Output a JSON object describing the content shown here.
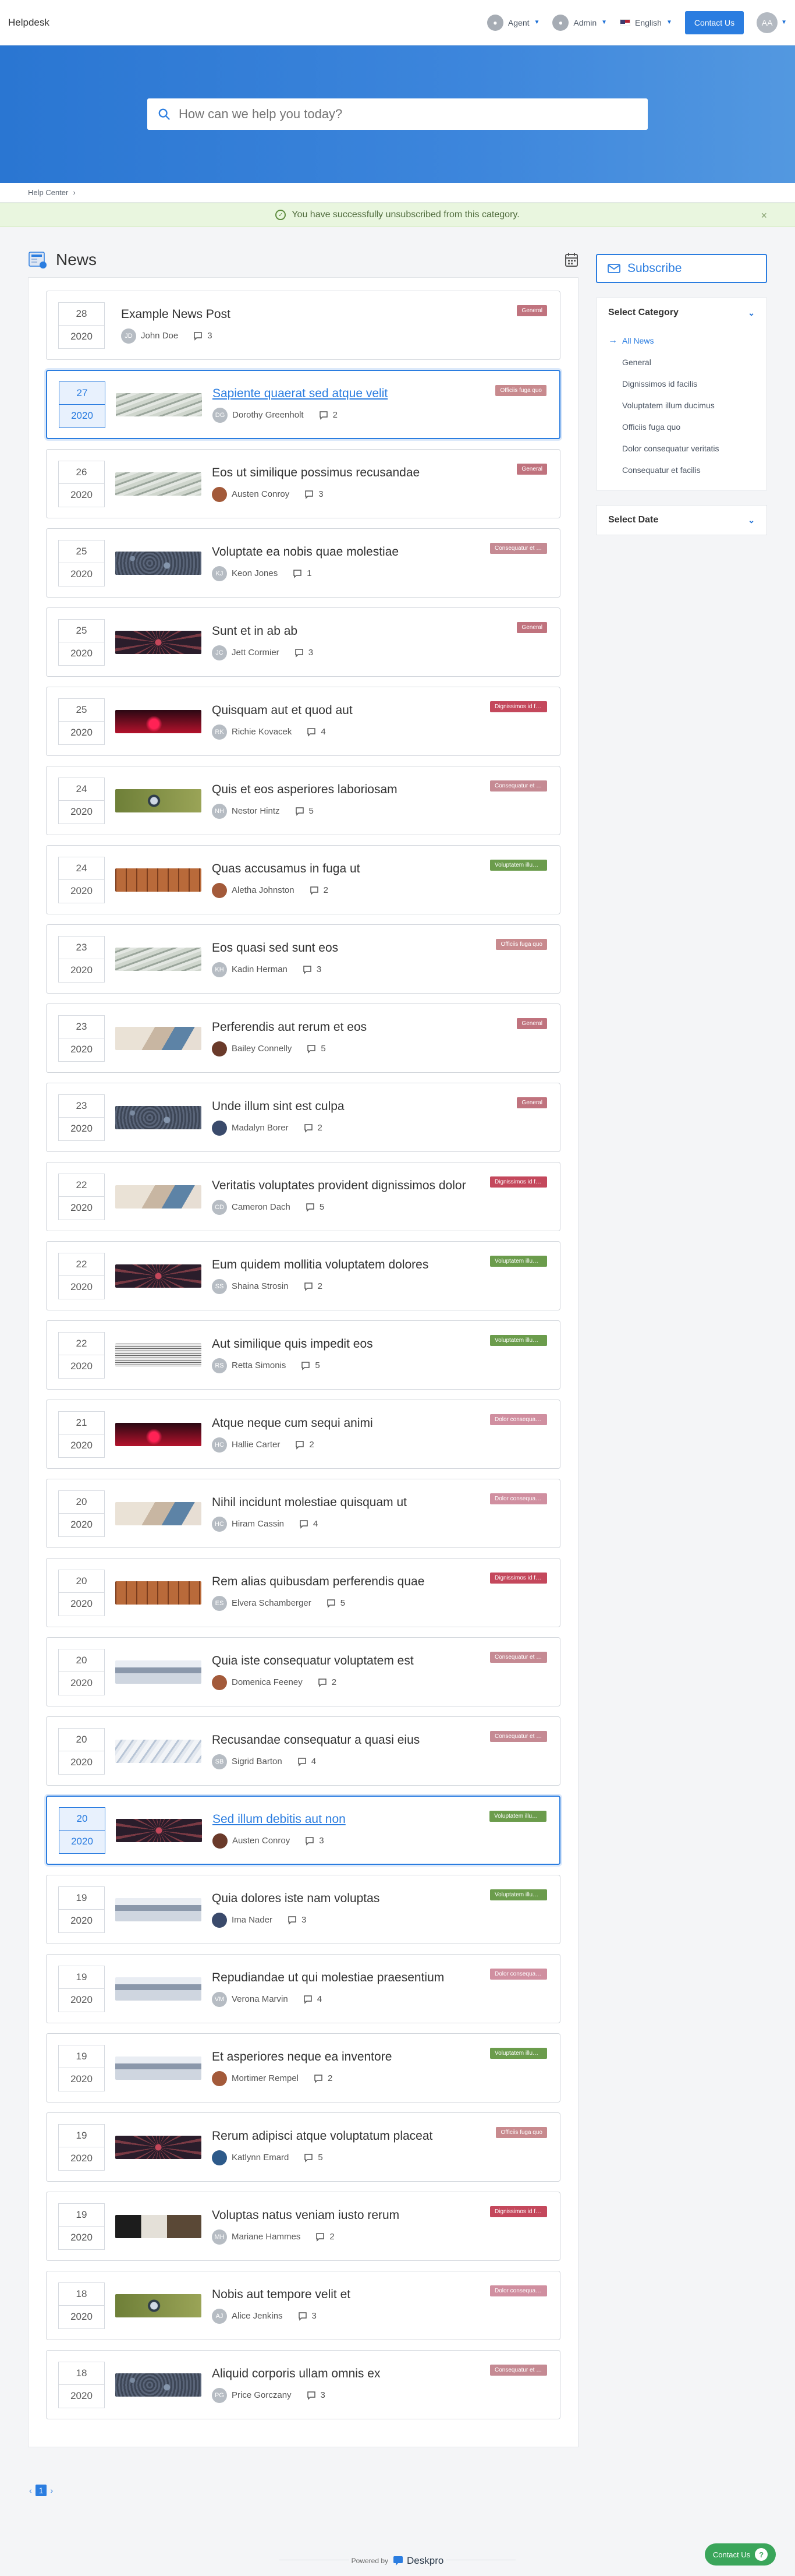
{
  "header": {
    "brand": "Helpdesk",
    "agent_label": "Agent",
    "admin_label": "Admin",
    "language": "English",
    "contact_label": "Contact Us",
    "user_initials": "AA"
  },
  "search": {
    "placeholder": "How can we help you today?"
  },
  "breadcrumb": {
    "item": "Help Center"
  },
  "alert": {
    "message": "You have successfully unsubscribed from this category."
  },
  "main": {
    "title": "News"
  },
  "colors": {
    "accent": "#2b7de0",
    "badge_general": "#c0737e",
    "badge_officiis": "#c88a8e",
    "badge_consequatur": "#c58a93",
    "badge_dignissimos": "#c4485c",
    "badge_voluptatem": "#6b9c4c",
    "badge_dolor": "#d08fa0"
  },
  "posts": [
    {
      "day": "28",
      "year": "2020",
      "title": "Example News Post",
      "author": "John Doe",
      "initials": "JD",
      "comments": "3",
      "badge": "General",
      "badge_color": "#c0737e",
      "thumb": "none",
      "hl": false
    },
    {
      "day": "27",
      "year": "2020",
      "title": "Sapiente quaerat sed atque velit",
      "author": "Dorothy Greenholt",
      "initials": "DG",
      "comments": "2",
      "badge": "Officiis fuga quo",
      "badge_color": "#c88a8e",
      "thumb": "money",
      "hl": true
    },
    {
      "day": "26",
      "year": "2020",
      "title": "Eos ut similique possimus recusandae",
      "author": "Austen Conroy",
      "initials": "AC",
      "comments": "3",
      "badge": "General",
      "badge_color": "#c0737e",
      "thumb": "money",
      "hl": false,
      "photo": true
    },
    {
      "day": "25",
      "year": "2020",
      "title": "Voluptate ea nobis quae molestiae",
      "author": "Keon Jones",
      "initials": "KJ",
      "comments": "1",
      "badge": "Consequatur et facilis",
      "badge_color": "#c58a93",
      "thumb": "stones",
      "hl": false
    },
    {
      "day": "25",
      "year": "2020",
      "title": "Sunt et in ab ab",
      "author": "Jett Cormier",
      "initials": "JC",
      "comments": "3",
      "badge": "General",
      "badge_color": "#c0737e",
      "thumb": "spider",
      "hl": false
    },
    {
      "day": "25",
      "year": "2020",
      "title": "Quisquam aut et quod aut",
      "author": "Richie Kovacek",
      "initials": "RK",
      "comments": "4",
      "badge": "Dignissimos id facilis",
      "badge_color": "#c4485c",
      "thumb": "concert",
      "hl": false
    },
    {
      "day": "24",
      "year": "2020",
      "title": "Quis et eos asperiores laboriosam",
      "author": "Nestor Hintz",
      "initials": "NH",
      "comments": "5",
      "badge": "Consequatur et facilis",
      "badge_color": "#c58a93",
      "thumb": "lens",
      "hl": false
    },
    {
      "day": "24",
      "year": "2020",
      "title": "Quas accusamus in fuga ut",
      "author": "Aletha Johnston",
      "initials": "AJ",
      "comments": "2",
      "badge": "Voluptatem illum ducimus",
      "badge_color": "#6b9c4c",
      "thumb": "drawers",
      "hl": false,
      "photo": true
    },
    {
      "day": "23",
      "year": "2020",
      "title": "Eos quasi sed sunt eos",
      "author": "Kadin Herman",
      "initials": "KH",
      "comments": "3",
      "badge": "Officiis fuga quo",
      "badge_color": "#c88a8e",
      "thumb": "money",
      "hl": false
    },
    {
      "day": "23",
      "year": "2020",
      "title": "Perferendis aut rerum et eos",
      "author": "Bailey Connelly",
      "initials": "BC",
      "comments": "5",
      "badge": "General",
      "badge_color": "#c0737e",
      "thumb": "tablet",
      "hl": false,
      "photo": true
    },
    {
      "day": "23",
      "year": "2020",
      "title": "Unde illum sint est culpa",
      "author": "Madalyn Borer",
      "initials": "MB",
      "comments": "2",
      "badge": "General",
      "badge_color": "#c0737e",
      "thumb": "stones",
      "hl": false,
      "photo": true
    },
    {
      "day": "22",
      "year": "2020",
      "title": "Veritatis voluptates provident dignissimos dolor",
      "author": "Cameron Dach",
      "initials": "CD",
      "comments": "5",
      "badge": "Dignissimos id facilis",
      "badge_color": "#c4485c",
      "thumb": "tablet",
      "hl": false
    },
    {
      "day": "22",
      "year": "2020",
      "title": "Eum quidem mollitia voluptatem dolores",
      "author": "Shaina Strosin",
      "initials": "SS",
      "comments": "2",
      "badge": "Voluptatem illum ducimus",
      "badge_color": "#6b9c4c",
      "thumb": "spider",
      "hl": false
    },
    {
      "day": "22",
      "year": "2020",
      "title": "Aut similique quis impedit eos",
      "author": "Retta Simonis",
      "initials": "RS",
      "comments": "5",
      "badge": "Voluptatem illum ducimus",
      "badge_color": "#6b9c4c",
      "thumb": "news",
      "hl": false
    },
    {
      "day": "21",
      "year": "2020",
      "title": "Atque neque cum sequi animi",
      "author": "Hallie Carter",
      "initials": "HC",
      "comments": "2",
      "badge": "Dolor consequatur veritatis",
      "badge_color": "#d08fa0",
      "thumb": "concert",
      "hl": false
    },
    {
      "day": "20",
      "year": "2020",
      "title": "Nihil incidunt molestiae quisquam ut",
      "author": "Hiram Cassin",
      "initials": "HC",
      "comments": "4",
      "badge": "Dolor consequatur veritatis",
      "badge_color": "#d08fa0",
      "thumb": "tablet",
      "hl": false
    },
    {
      "day": "20",
      "year": "2020",
      "title": "Rem alias quibusdam perferendis quae",
      "author": "Elvera Schamberger",
      "initials": "ES",
      "comments": "5",
      "badge": "Dignissimos id facilis",
      "badge_color": "#c4485c",
      "thumb": "drawers",
      "hl": false
    },
    {
      "day": "20",
      "year": "2020",
      "title": "Quia iste consequatur voluptatem est",
      "author": "Domenica Feeney",
      "initials": "DF",
      "comments": "2",
      "badge": "Consequatur et facilis",
      "badge_color": "#c58a93",
      "thumb": "snow",
      "hl": false,
      "photo": true
    },
    {
      "day": "20",
      "year": "2020",
      "title": "Recusandae consequatur a quasi eius",
      "author": "Sigrid Barton",
      "initials": "SB",
      "comments": "4",
      "badge": "Consequatur et facilis",
      "badge_color": "#c58a93",
      "thumb": "paper",
      "hl": false
    },
    {
      "day": "20",
      "year": "2020",
      "title": "Sed illum debitis aut non",
      "author": "Austen Conroy",
      "initials": "AC",
      "comments": "3",
      "badge": "Voluptatem illum ducimus",
      "badge_color": "#6b9c4c",
      "thumb": "spider",
      "hl": true,
      "photo": true
    },
    {
      "day": "19",
      "year": "2020",
      "title": "Quia dolores iste nam voluptas",
      "author": "Ima Nader",
      "initials": "IN",
      "comments": "3",
      "badge": "Voluptatem illum ducimus",
      "badge_color": "#6b9c4c",
      "thumb": "snow",
      "hl": false,
      "photo": true
    },
    {
      "day": "19",
      "year": "2020",
      "title": "Repudiandae ut qui molestiae praesentium",
      "author": "Verona Marvin",
      "initials": "VM",
      "comments": "4",
      "badge": "Dolor consequatur veritatis",
      "badge_color": "#d08fa0",
      "thumb": "snow",
      "hl": false
    },
    {
      "day": "19",
      "year": "2020",
      "title": "Et asperiores neque ea inventore",
      "author": "Mortimer Rempel",
      "initials": "MR",
      "comments": "2",
      "badge": "Voluptatem illum ducimus",
      "badge_color": "#6b9c4c",
      "thumb": "snow",
      "hl": false,
      "photo": true
    },
    {
      "day": "19",
      "year": "2020",
      "title": "Rerum adipisci atque voluptatum placeat",
      "author": "Katlynn Emard",
      "initials": "KE",
      "comments": "5",
      "badge": "Officiis fuga quo",
      "badge_color": "#c88a8e",
      "thumb": "spider",
      "hl": false,
      "photo": true
    },
    {
      "day": "19",
      "year": "2020",
      "title": "Voluptas natus veniam iusto rerum",
      "author": "Mariane Hammes",
      "initials": "MH",
      "comments": "2",
      "badge": "Dignissimos id facilis",
      "badge_color": "#c4485c",
      "thumb": "piano",
      "hl": false
    },
    {
      "day": "18",
      "year": "2020",
      "title": "Nobis aut tempore velit et",
      "author": "Alice Jenkins",
      "initials": "AJ",
      "comments": "3",
      "badge": "Dolor consequatur veritatis",
      "badge_color": "#d08fa0",
      "thumb": "lens",
      "hl": false
    },
    {
      "day": "18",
      "year": "2020",
      "title": "Aliquid corporis ullam omnis ex",
      "author": "Price Gorczany",
      "initials": "PG",
      "comments": "3",
      "badge": "Consequatur et facilis",
      "badge_color": "#c58a93",
      "thumb": "stones",
      "hl": false
    }
  ],
  "pagination": {
    "prev": "‹",
    "current": "1",
    "next": "›"
  },
  "sidebar": {
    "subscribe_label": "Subscribe",
    "category_title": "Select Category",
    "categories": [
      "All News",
      "General",
      "Dignissimos id facilis",
      "Voluptatem illum ducimus",
      "Officiis fuga quo",
      "Dolor consequatur veritatis",
      "Consequatur et facilis"
    ],
    "date_title": "Select Date"
  },
  "footer": {
    "powered_by": "Powered by",
    "product": "Deskpro"
  },
  "floating": {
    "contact_label": "Contact Us"
  }
}
